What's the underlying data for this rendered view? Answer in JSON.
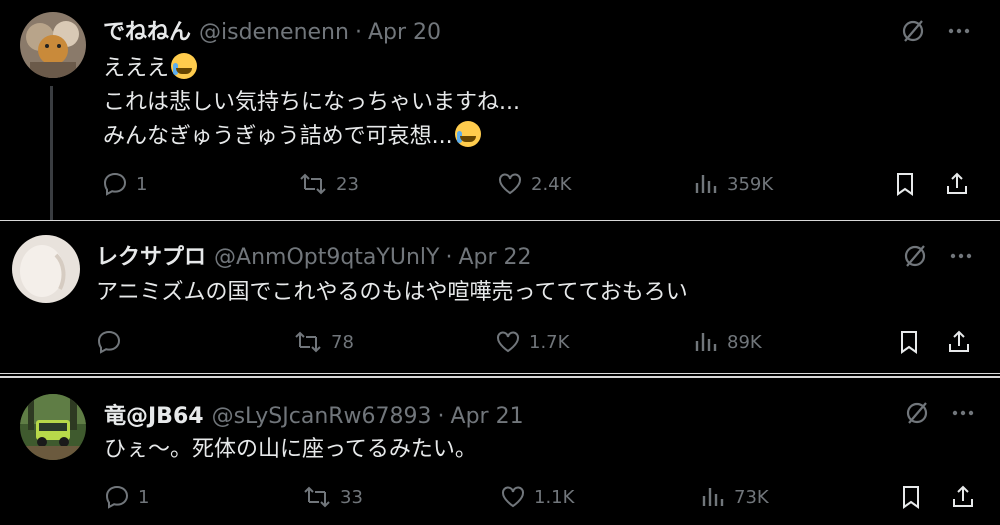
{
  "tweets": [
    {
      "name": "でねねん",
      "handle": "@isdenenenn",
      "dot": "·",
      "date": "Apr 20",
      "lines": [
        "えええ",
        "これは悲しい気持ちになっちゃいますね...",
        "みんなぎゅうぎゅう詰めで可哀想..."
      ],
      "emojis": [
        "loudly-crying-face",
        "crying-face"
      ],
      "replies": "1",
      "retweets": "23",
      "likes": "2.4K",
      "views": "359K"
    },
    {
      "name": "レクサプロ",
      "handle": "@AnmOpt9qtaYUnlY",
      "dot": "·",
      "date": "Apr 22",
      "lines": [
        "アニミズムの国でこれやるのもはや喧嘩売っててておもろい"
      ],
      "replies": "",
      "retweets": "78",
      "likes": "1.7K",
      "views": "89K"
    },
    {
      "name": "竜@JB64",
      "handle": "@sLySJcanRw67893",
      "dot": "·",
      "date": "Apr 21",
      "lines": [
        "ひぇ〜。死体の山に座ってるみたい。"
      ],
      "replies": "1",
      "retweets": "33",
      "likes": "1.1K",
      "views": "73K"
    }
  ],
  "colors": {
    "background": "#000000",
    "text": "#e7e9ea",
    "muted": "#71767b",
    "thread": "#3a3d41"
  },
  "icons": [
    "reply-icon",
    "retweet-icon",
    "like-icon",
    "views-icon",
    "bookmark-icon",
    "share-icon",
    "grok-icon",
    "more-icon"
  ]
}
